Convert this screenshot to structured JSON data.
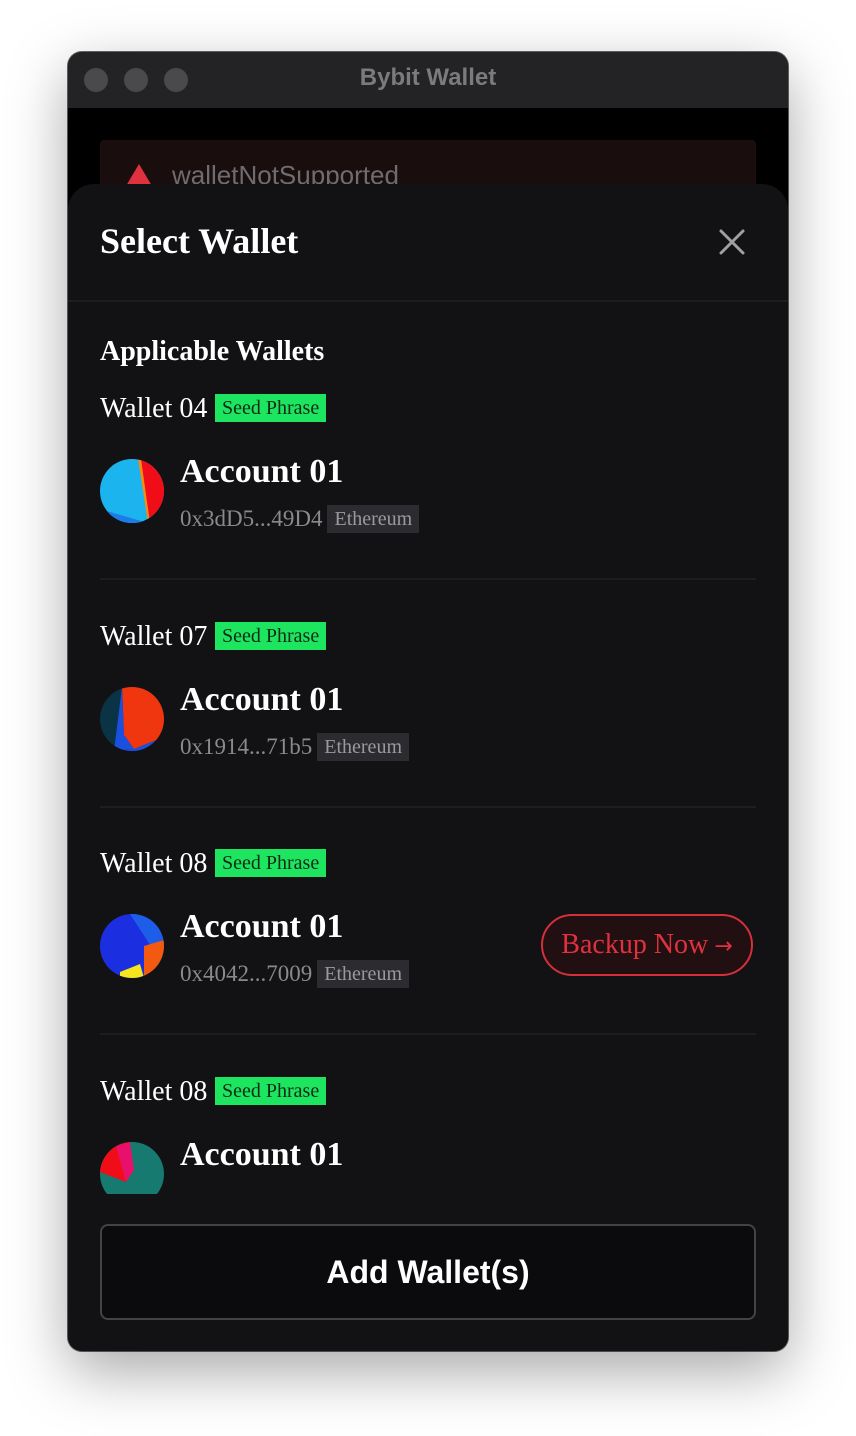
{
  "window": {
    "title": "Bybit Wallet"
  },
  "background_alert": {
    "text": "walletNotSupported"
  },
  "sheet": {
    "title": "Select Wallet",
    "section_title": "Applicable Wallets",
    "add_button_label": "Add Wallet(s)"
  },
  "wallets": [
    {
      "name": "Wallet 04",
      "tag": "Seed Phrase",
      "account_name": "Account 01",
      "address": "0x3dD5...49D4",
      "chain": "Ethereum",
      "avatar_colors": [
        "#1cb4ef",
        "#f00d18",
        "#f28c12",
        "#1d7de8"
      ]
    },
    {
      "name": "Wallet 07",
      "tag": "Seed Phrase",
      "account_name": "Account 01",
      "address": "0x1914...71b5",
      "chain": "Ethereum",
      "avatar_colors": [
        "#0b3346",
        "#f0360e",
        "#1b4fe0",
        "#f47412"
      ]
    },
    {
      "name": "Wallet 08",
      "tag": "Seed Phrase",
      "account_name": "Account 01",
      "address": "0x4042...7009",
      "chain": "Ethereum",
      "avatar_colors": [
        "#1b2fe0",
        "#1e5de8",
        "#f25a10",
        "#f6e61b"
      ],
      "action_label": "Backup Now"
    },
    {
      "name": "Wallet 08",
      "tag": "Seed Phrase",
      "account_name": "Account 01",
      "avatar_colors": [
        "#167a70",
        "#f00d18",
        "#e8106b"
      ]
    }
  ],
  "colors": {
    "accent_green": "#1ee55f",
    "danger_red": "#e0323e",
    "sheet_bg": "#121214"
  }
}
